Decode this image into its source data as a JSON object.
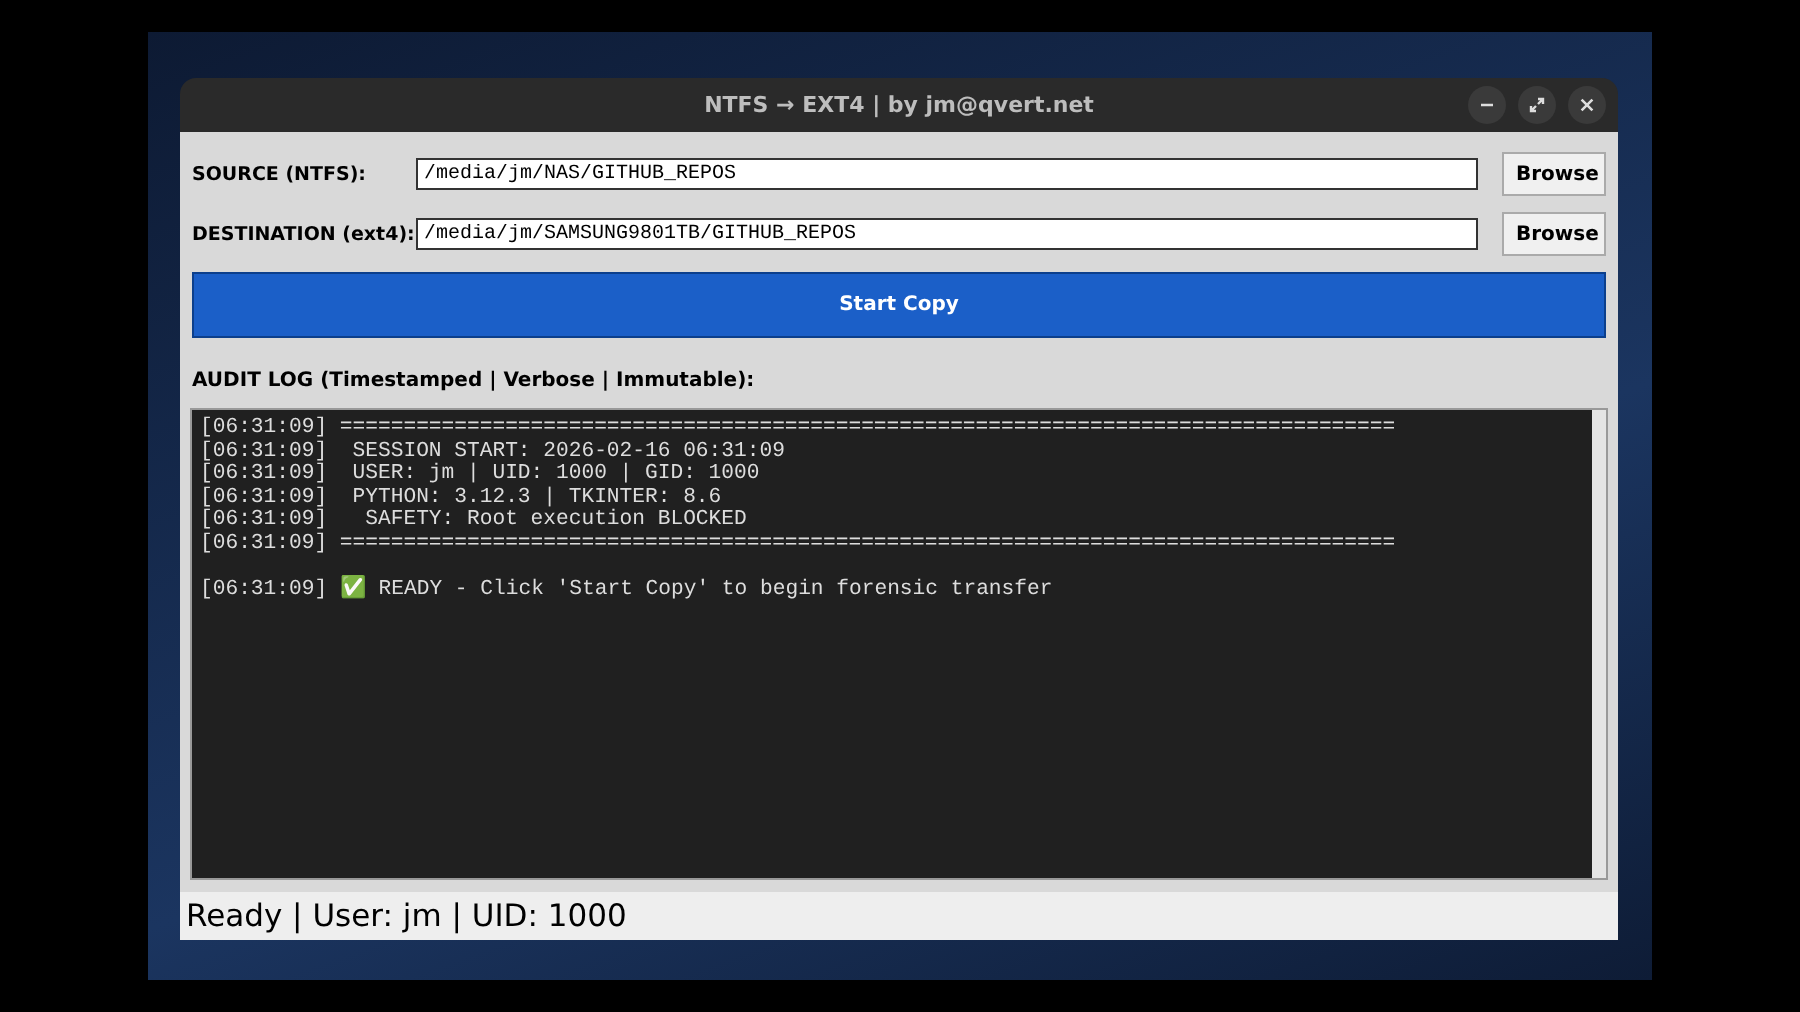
{
  "window": {
    "title": "NTFS → EXT4 | by jm@qvert.net"
  },
  "fields": [
    {
      "label": "SOURCE (NTFS):",
      "value": "/media/jm/NAS/GITHUB_REPOS",
      "button": "Browse"
    },
    {
      "label": "DESTINATION (ext4):",
      "value": "/media/jm/SAMSUNG9801TB/GITHUB_REPOS",
      "button": "Browse"
    }
  ],
  "start_button": "Start Copy",
  "log_label": "AUDIT LOG (Timestamped | Verbose | Immutable):",
  "log_header": [
    "[06:31:09] ===================================================================================",
    "[06:31:09]  SESSION START: 2026-02-16 06:31:09",
    "[06:31:09]  USER: jm | UID: 1000 | GID: 1000",
    "[06:31:09]  PYTHON: 3.12.3 | TKINTER: 8.6",
    "[06:31:09]   SAFETY: Root execution BLOCKED",
    "[06:31:09] ==================================================================================="
  ],
  "log_messages": [
    "[06:31:09] ✅ READY - Click 'Start Copy' to begin forensic transfer"
  ],
  "status_bar": "Ready | User: jm | UID: 1000"
}
